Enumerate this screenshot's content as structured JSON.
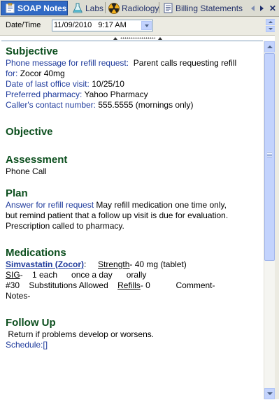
{
  "tabs": [
    {
      "label": "SOAP Notes",
      "icon": "notepad-icon",
      "active": true
    },
    {
      "label": "Labs",
      "icon": "flask-icon",
      "active": false
    },
    {
      "label": "Radiology",
      "icon": "radiation-icon",
      "active": false
    },
    {
      "label": "Billing Statements",
      "icon": "document-icon",
      "active": false
    }
  ],
  "tab_nav": {
    "left": "◀",
    "right": "▶",
    "close": "✕"
  },
  "datetime": {
    "label": "Date/Time",
    "value": "11/09/2010   9:17 AM"
  },
  "subjective": {
    "heading": "Subjective",
    "refill_label": "Phone message for refill request:",
    "refill_text": "Parent calls requesting refill",
    "refill_for_label": "for:",
    "refill_for_value": "Zocor 40mg",
    "last_visit_label": "Date of last office visit:",
    "last_visit_value": "10/25/10",
    "pharmacy_label": "Preferred pharmacy:",
    "pharmacy_value": "Yahoo Pharmacy",
    "contact_label": "Caller's contact number:",
    "contact_value": "555.5555 (mornings only)"
  },
  "objective": {
    "heading": "Objective"
  },
  "assessment": {
    "heading": "Assessment",
    "text": "Phone Call"
  },
  "plan": {
    "heading": "Plan",
    "answer_label": "Answer for refill request",
    "text1": "May refill medication one time only,",
    "text2": "but remind patient that a follow up visit is due for evaluation.",
    "text3": "Prescription called to pharmacy."
  },
  "medications": {
    "heading": "Medications",
    "drug": "Simvastatin (Zocor)",
    "strength_label": "Strength",
    "strength_value": "- 40 mg (tablet)",
    "sig_label": "SIG",
    "sig_value": "-    1 each      once a day      orally",
    "quantity": "#30",
    "substitutions": "Substitutions Allowed",
    "refills_label": "Refills",
    "refills_value": "- 0",
    "comment_label": "Comment-",
    "notes_label": "Notes-"
  },
  "followup": {
    "heading": "Follow Up",
    "text": "Return if problems develop or worsens.",
    "schedule": "Schedule:[]"
  },
  "colors": {
    "active_tab": "#316ac5",
    "heading_green": "#0c4f1e",
    "label_blue": "#1f3b9c"
  }
}
